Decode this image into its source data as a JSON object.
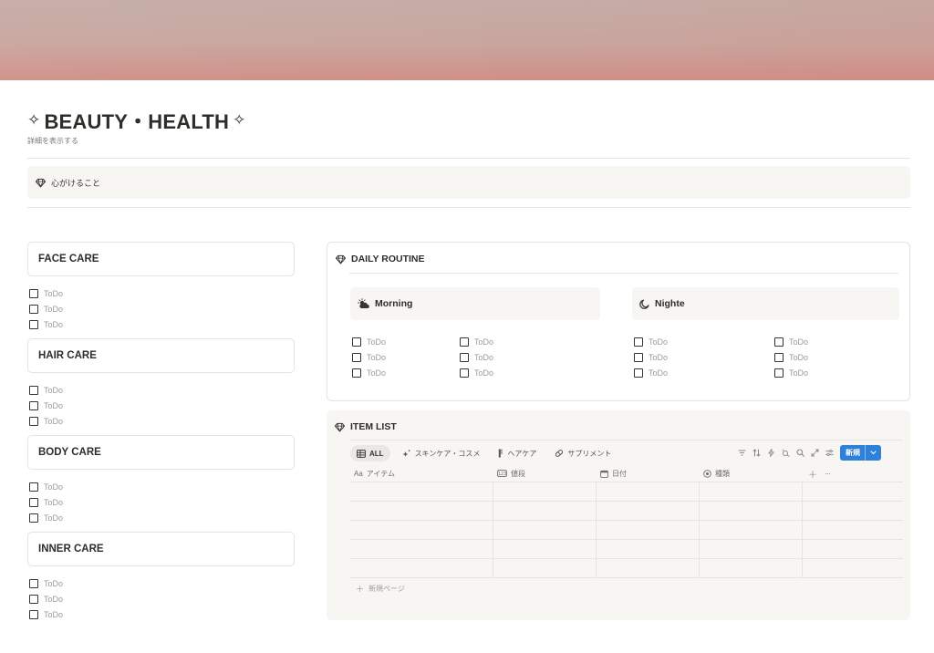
{
  "page": {
    "title": "BEAUTY・HEALTH",
    "title_prefix_icon": "sparkle-icon",
    "title_suffix_icon": "sparkle-icon",
    "title_left_glyph": "✧",
    "title_right_glyph": "✧",
    "subtitle": "詳細を表示する",
    "cover_colors": [
      "#c4ada6",
      "#c9a59e",
      "#d08f86"
    ]
  },
  "callout": {
    "icon": "gem-icon",
    "text": "心がけること"
  },
  "care_sections": [
    {
      "title": "FACE CARE",
      "todos": [
        "ToDo",
        "ToDo",
        "ToDo"
      ]
    },
    {
      "title": "HAIR CARE",
      "todos": [
        "ToDo",
        "ToDo",
        "ToDo"
      ]
    },
    {
      "title": "BODY CARE",
      "todos": [
        "ToDo",
        "ToDo",
        "ToDo"
      ]
    },
    {
      "title": "INNER CARE",
      "todos": [
        "ToDo",
        "ToDo",
        "ToDo"
      ]
    }
  ],
  "daily_routine": {
    "title": "DAILY ROUTINE",
    "icon": "gem-icon",
    "morning": {
      "label": "Morning",
      "icon": "sun-cloud-icon",
      "col1": [
        "ToDo",
        "ToDo",
        "ToDo"
      ],
      "col2": [
        "ToDo",
        "ToDo",
        "ToDo"
      ]
    },
    "night": {
      "label": "Nighte",
      "icon": "moon-icon",
      "col1": [
        "ToDo",
        "ToDo",
        "ToDo"
      ],
      "col2": [
        "ToDo",
        "ToDo",
        "ToDo"
      ]
    }
  },
  "item_list": {
    "title": "ITEM LIST",
    "icon": "gem-icon",
    "views": [
      {
        "label": "ALL",
        "icon": "table-icon",
        "active": true
      },
      {
        "label": "スキンケア・コスメ",
        "icon": "sparkles-icon",
        "active": false
      },
      {
        "label": "ヘアケア",
        "icon": "comb-icon",
        "active": false
      },
      {
        "label": "サプリメント",
        "icon": "pill-icon",
        "active": false
      }
    ],
    "tools": [
      "filter-icon",
      "sort-icon",
      "lightning-icon",
      "magic-icon",
      "search-icon",
      "expand-icon",
      "settings-icon"
    ],
    "new_button": "新規",
    "columns": [
      {
        "label": "アイテム",
        "icon_text": "Aa"
      },
      {
        "label": "値段",
        "icon": "price-tag-icon"
      },
      {
        "label": "日付",
        "icon": "calendar-icon"
      },
      {
        "label": "種類",
        "icon": "select-icon"
      }
    ],
    "add_column_icon": "plus-icon",
    "more_icon": "more-icon",
    "add_glyph": "＋",
    "more_glyph": "···",
    "row_count": 5,
    "new_page": "新規ページ",
    "new_page_glyph": "＋"
  },
  "accent_color": "#2f80d8"
}
